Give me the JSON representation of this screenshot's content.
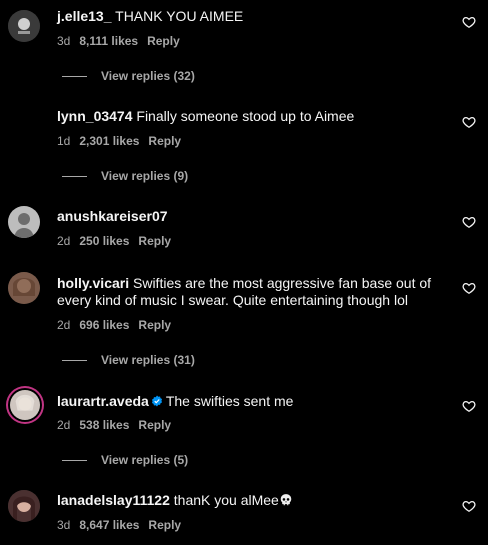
{
  "comments": [
    {
      "username": "j.elle13_",
      "text": " THANK YOU AIMEE",
      "age": "3d",
      "likes": "8,111 likes",
      "reply": "Reply",
      "view_replies": "View replies (32)"
    },
    {
      "username": "lynn_03474",
      "text": " Finally someone stood up to Aimee",
      "age": "1d",
      "likes": "2,301 likes",
      "reply": "Reply",
      "view_replies": "View replies (9)"
    },
    {
      "username": "anushkareiser07",
      "text": "",
      "age": "2d",
      "likes": "250 likes",
      "reply": "Reply"
    },
    {
      "username": "holly.vicari",
      "text": " Swifties are the most aggressive fan base out of every kind of music I swear. Quite entertaining though lol",
      "age": "2d",
      "likes": "696 likes",
      "reply": "Reply",
      "view_replies": "View replies (31)"
    },
    {
      "username": "laurartr.aveda",
      "verified": true,
      "text": "The swifties sent me",
      "age": "2d",
      "likes": "538 likes",
      "reply": "Reply",
      "view_replies": "View replies (5)"
    },
    {
      "username": "lanadelslay11122",
      "text": " thanK you alMee",
      "emoji": "skull",
      "age": "3d",
      "likes": "8,647 likes",
      "reply": "Reply"
    }
  ],
  "icons": {
    "like": "heart-outline-icon",
    "verified": "verified-badge-icon",
    "emoji": "skull-emoji-icon"
  },
  "colors": {
    "background": "#000000",
    "text": "#f5f5f5",
    "secondary_text": "#a8a8a8",
    "verified": "#0095f6",
    "story_ring": "#c13584"
  }
}
